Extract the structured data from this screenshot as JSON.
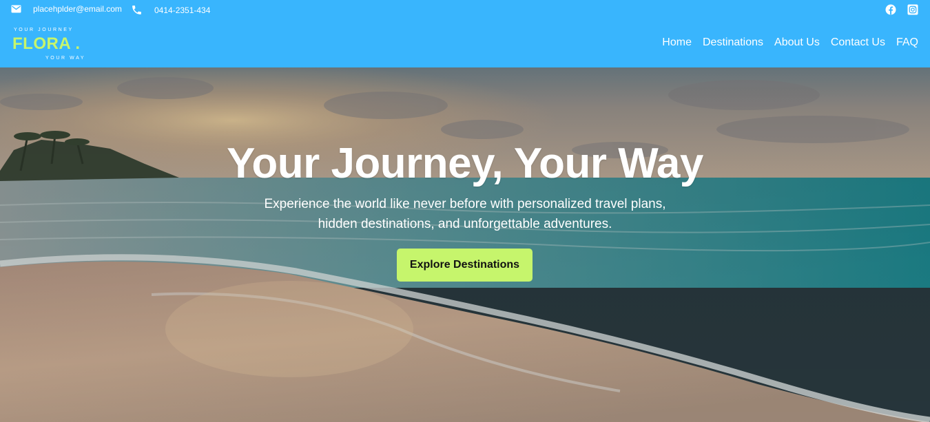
{
  "topbar": {
    "email": "placehplder@email.com",
    "phone": "0414-2351-434",
    "social": [
      {
        "icon": "facebook-icon"
      },
      {
        "icon": "instagram-icon"
      }
    ]
  },
  "logo": {
    "tag_top": "YOUR JOURNEY",
    "brand": "FLORA .",
    "tag_bottom": "YOUR WAY"
  },
  "nav": {
    "items": [
      {
        "label": "Home"
      },
      {
        "label": "Destinations"
      },
      {
        "label": "About Us"
      },
      {
        "label": "Contact Us"
      },
      {
        "label": "FAQ"
      }
    ]
  },
  "hero": {
    "title": "Your Journey, Your Way",
    "subtitle_line1": "Experience the world like never before with personalized travel plans,",
    "subtitle_line2": "hidden destinations, and unforgettable adventures.",
    "cta_label": "Explore Destinations"
  },
  "colors": {
    "header_bg": "#39b5fd",
    "accent": "#c6f56c",
    "text_on_header": "#ffffff"
  }
}
